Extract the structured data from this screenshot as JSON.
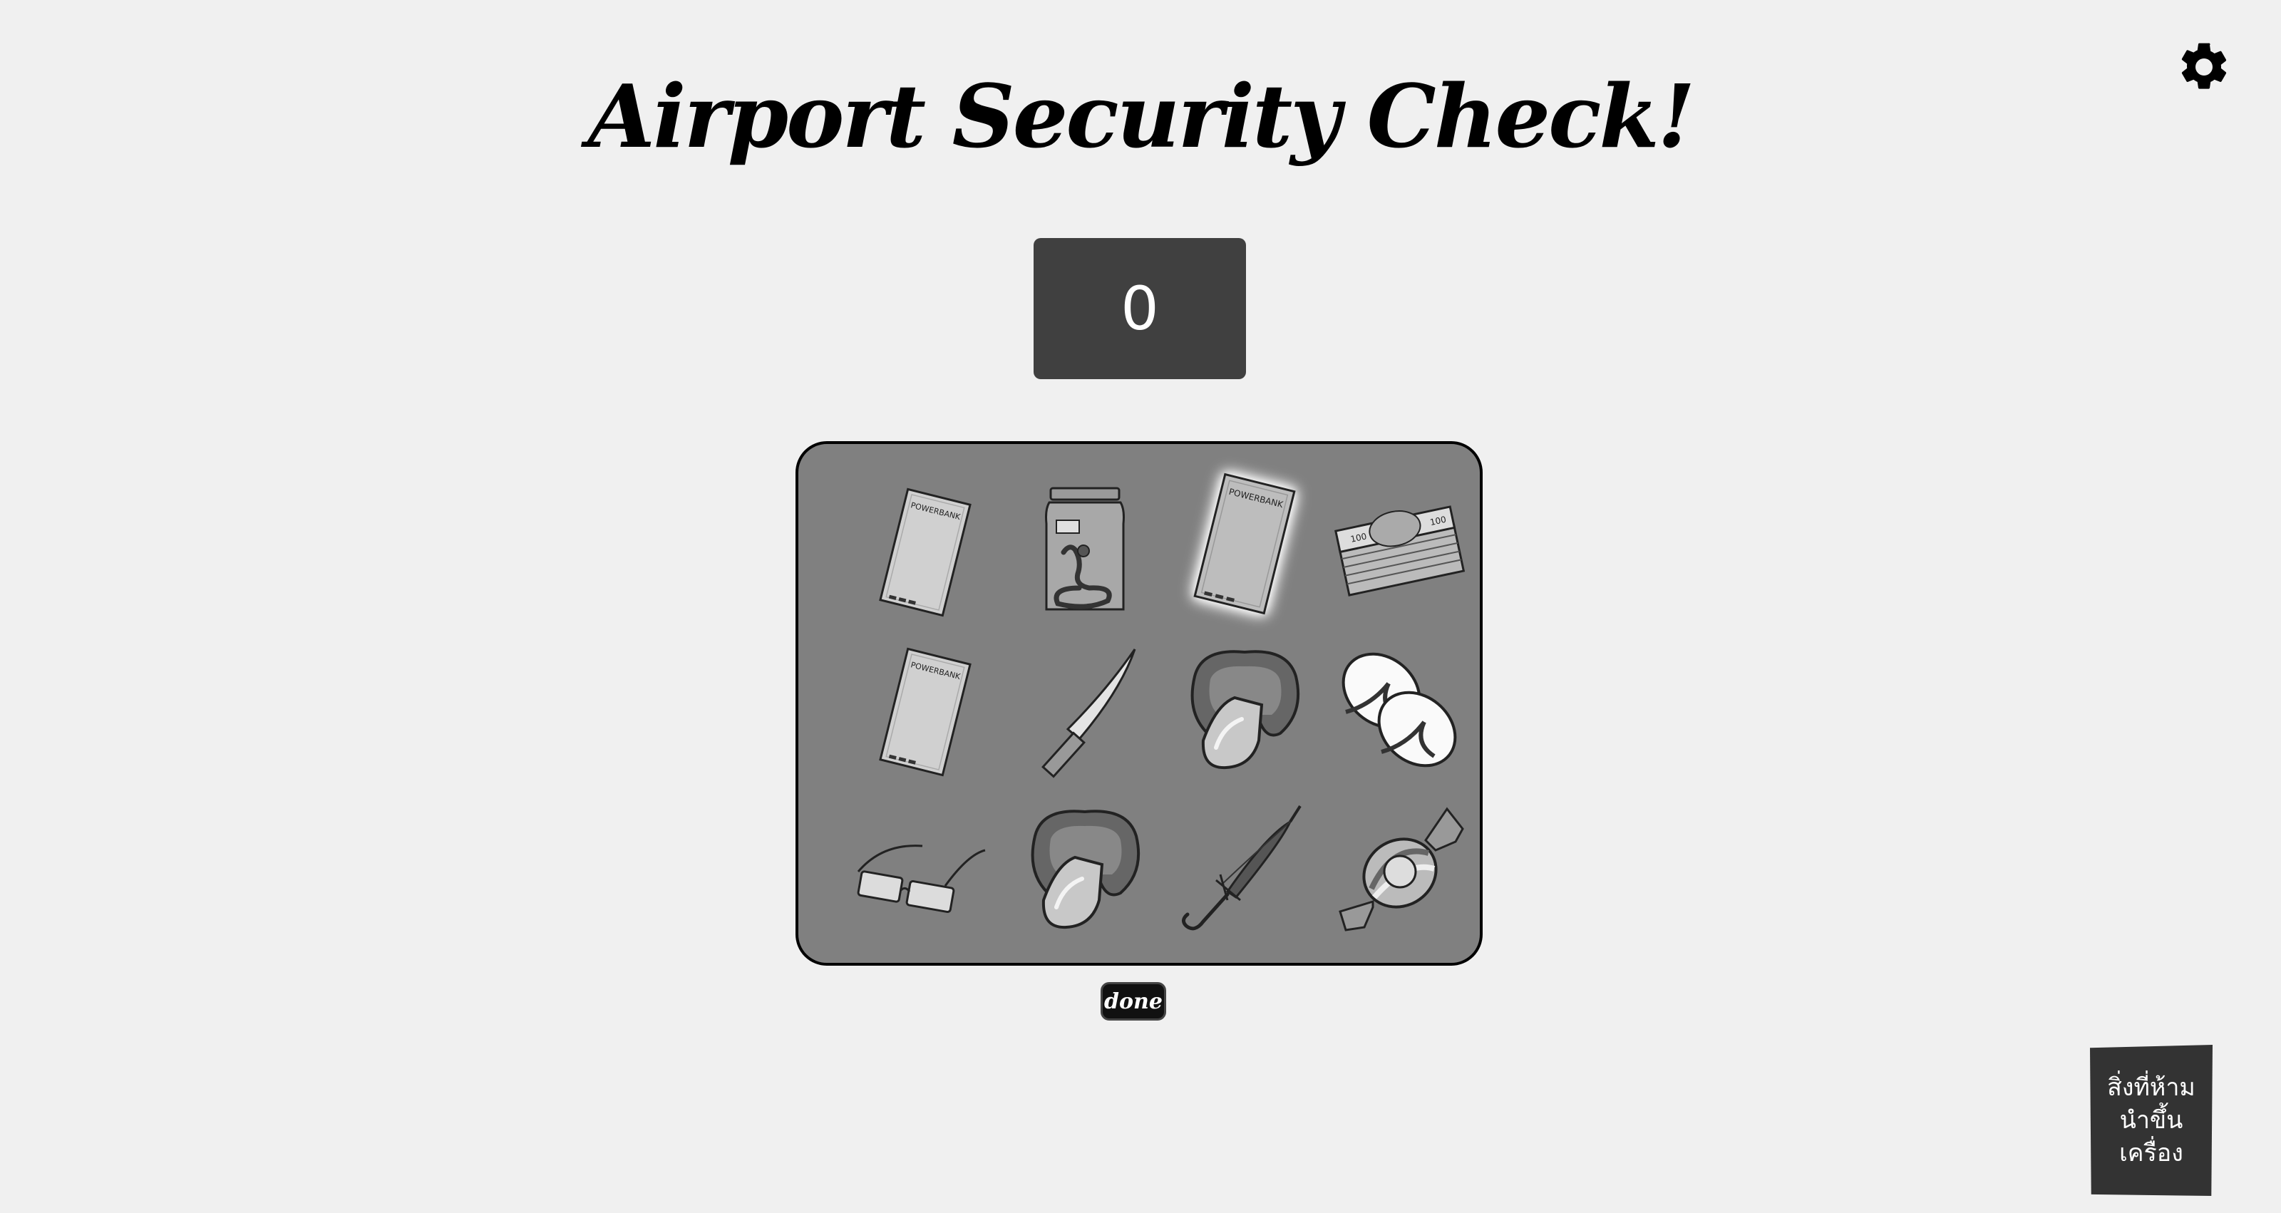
{
  "title": "Airport Security Check!",
  "score": "0",
  "done_label": "done",
  "info_card_text": "สิ่งที่ห้ามนำขึ้นเครื่อง",
  "settings_icon": "gear-icon",
  "grid": {
    "rows": 3,
    "cols": 4,
    "items": [
      {
        "icon": "powerbank-icon",
        "highlighted": false
      },
      {
        "icon": "snake-jar-icon",
        "highlighted": false
      },
      {
        "icon": "powerbank-icon",
        "highlighted": true
      },
      {
        "icon": "cash-stack-icon",
        "highlighted": false
      },
      {
        "icon": "powerbank-icon",
        "highlighted": false
      },
      {
        "icon": "knife-icon",
        "highlighted": false
      },
      {
        "icon": "handcuffs-icon",
        "highlighted": false
      },
      {
        "icon": "flip-flops-icon",
        "highlighted": false
      },
      {
        "icon": "glasses-icon",
        "highlighted": false
      },
      {
        "icon": "handcuffs-icon",
        "highlighted": false
      },
      {
        "icon": "umbrella-icon",
        "highlighted": false
      },
      {
        "icon": "candy-icon",
        "highlighted": false
      }
    ]
  }
}
